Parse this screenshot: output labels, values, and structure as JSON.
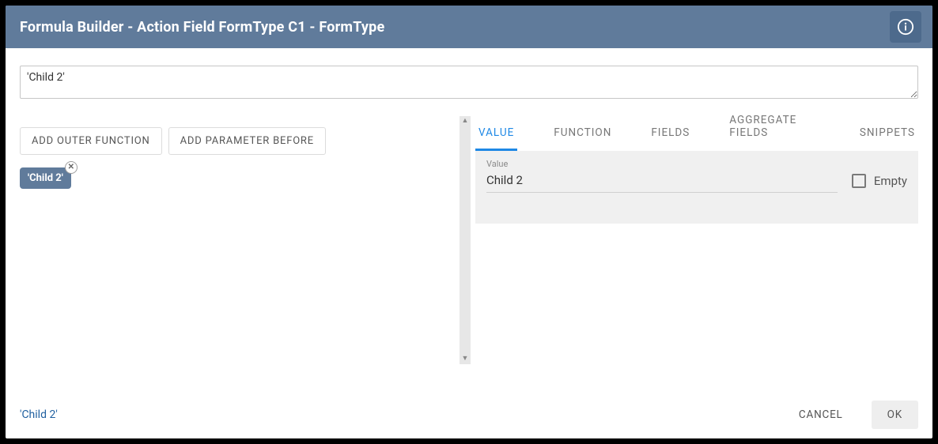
{
  "header": {
    "title": "Formula Builder - Action Field FormType C1 - FormType",
    "info_icon": "info-icon"
  },
  "expression": {
    "value": "'Child 2'"
  },
  "toolbar": {
    "add_outer_function": "ADD OUTER FUNCTION",
    "add_parameter_before": "ADD PARAMETER BEFORE"
  },
  "tokens": [
    {
      "text": "'Child 2'"
    }
  ],
  "tabs": {
    "items": [
      {
        "label": "VALUE",
        "selected": true
      },
      {
        "label": "FUNCTION",
        "selected": false
      },
      {
        "label": "FIELDS",
        "selected": false
      },
      {
        "label": "AGGREGATE FIELDS",
        "selected": false
      },
      {
        "label": "SNIPPETS",
        "selected": false
      }
    ]
  },
  "value_panel": {
    "label": "Value",
    "value": "Child 2",
    "empty_label": "Empty",
    "empty_checked": false
  },
  "footer": {
    "preview": "'Child 2'",
    "cancel": "CANCEL",
    "ok": "OK"
  }
}
